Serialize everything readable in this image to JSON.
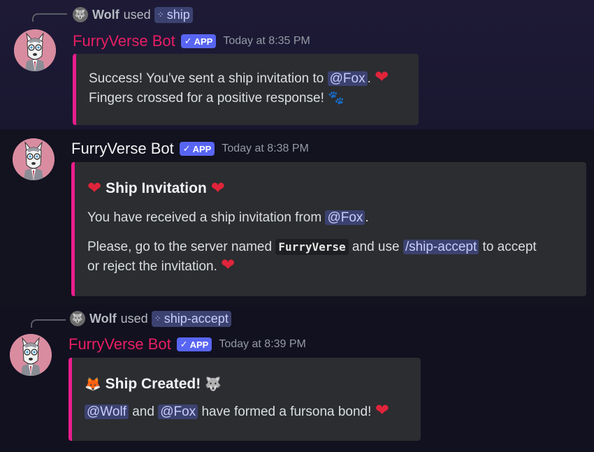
{
  "messages": [
    {
      "reply": {
        "user": "Wolf",
        "used": "used",
        "command": "ship"
      },
      "author": "FurryVerse Bot",
      "tag": "APP",
      "time": "Today at 8:35 PM",
      "embed": {
        "line1_pre": "Success! You've sent a ship invitation to ",
        "mention": "@Fox",
        "line1_post": ".",
        "line2": "Fingers crossed for a positive response!"
      }
    },
    {
      "author": "FurryVerse Bot",
      "tag": "APP",
      "time": "Today at 8:38 PM",
      "embed": {
        "title": "Ship Invitation",
        "line1_pre": "You have received a ship invitation from ",
        "mention": "@Fox",
        "line1_post": ".",
        "line2_pre": "Please, go to the server named ",
        "server": "FurryVerse",
        "line2_mid": " and use ",
        "command": "/ship-accept",
        "line2_post": " to accept",
        "line3": "or reject the invitation."
      }
    },
    {
      "reply": {
        "user": "Wolf",
        "used": "used",
        "command": "ship-accept"
      },
      "author": "FurryVerse Bot",
      "tag": "APP",
      "time": "Today at 8:39 PM",
      "embed": {
        "title": "Ship Created!",
        "mention1": "@Wolf",
        "and": " and ",
        "mention2": "@Fox",
        "line_post": " have formed a fursona bond!"
      }
    }
  ],
  "icons": [
    "paws-icon",
    "heart-icon",
    "fox-icon",
    "wolf-icon",
    "slash-command-icon",
    "check-icon"
  ],
  "colors": {
    "accent": "#e91e8c",
    "brand": "#5865f2",
    "bot_name": "#e91e63",
    "heart": "#e0243a"
  }
}
